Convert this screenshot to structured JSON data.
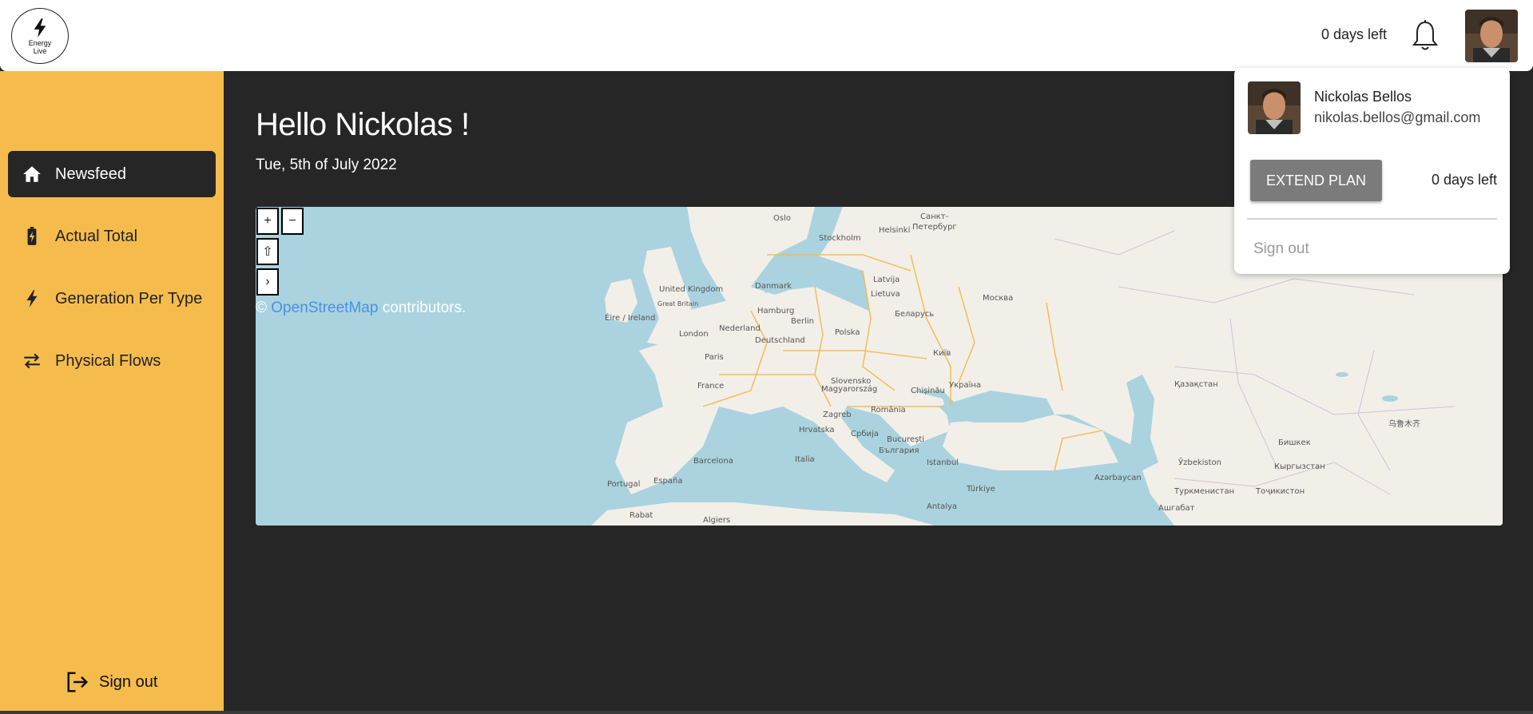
{
  "app": {
    "logo_text_line1": "Energy",
    "logo_text_line2": "Live"
  },
  "header": {
    "days_left": "0 days left",
    "avatar_alt": "user avatar"
  },
  "sidebar": {
    "items": [
      {
        "label": "Newsfeed",
        "icon": "home-icon",
        "active": true
      },
      {
        "label": "Actual Total",
        "icon": "battery-charging-icon",
        "active": false
      },
      {
        "label": "Generation Per Type",
        "icon": "lightning-icon",
        "active": false
      },
      {
        "label": "Physical Flows",
        "icon": "swap-arrows-icon",
        "active": false
      }
    ],
    "sign_out": "Sign out"
  },
  "main": {
    "greeting": "Hello Nickolas !",
    "date": "Tue, 5th of July 2022"
  },
  "map": {
    "zoom_in": "+",
    "zoom_out": "−",
    "home": "⇧",
    "expand": "›",
    "attribution_prefix": "©",
    "attribution_link": "OpenStreetMap",
    "attribution_suffix": "contributors.",
    "labels": [
      "Oslo",
      "Stockholm",
      "Helsinki",
      "Санкт-Петербург",
      "United Kingdom",
      "Great Britain",
      "Danmark",
      "Hamburg",
      "Berlin",
      "Nederland",
      "Deutschland",
      "Polska",
      "Lietuva",
      "Latvija",
      "Беларусь",
      "Москва",
      "Éire / Ireland",
      "London",
      "Paris",
      "France",
      "Київ",
      "Україна",
      "Magyarország",
      "România",
      "Chișinău",
      "Slovensko",
      "Zagreb",
      "Hrvatska",
      "Србија",
      "București",
      "България",
      "Italia",
      "Barcelona",
      "España",
      "Portugal",
      "Istanbul",
      "Türkiye",
      "Antalya",
      "Rabat",
      "Algiers",
      "Azərbaycan",
      "Қазақстан",
      "Ўzbekiston",
      "Туркменистан",
      "Ашгабат",
      "Бишкек",
      "Кыргызстан",
      "Тоҷикистон",
      "乌鲁木齐"
    ]
  },
  "user_menu": {
    "name": "Nickolas Bellos",
    "email": "nikolas.bellos@gmail.com",
    "extend_plan": "EXTEND PLAN",
    "days_left": "0 days left",
    "sign_out": "Sign out"
  },
  "colors": {
    "sidebar": "#f5bc4d",
    "background": "#262626",
    "active_nav": "#262626",
    "sea": "#aad3df",
    "land": "#f2efe9",
    "border": "#f4b94e",
    "link": "#4a90e2"
  }
}
